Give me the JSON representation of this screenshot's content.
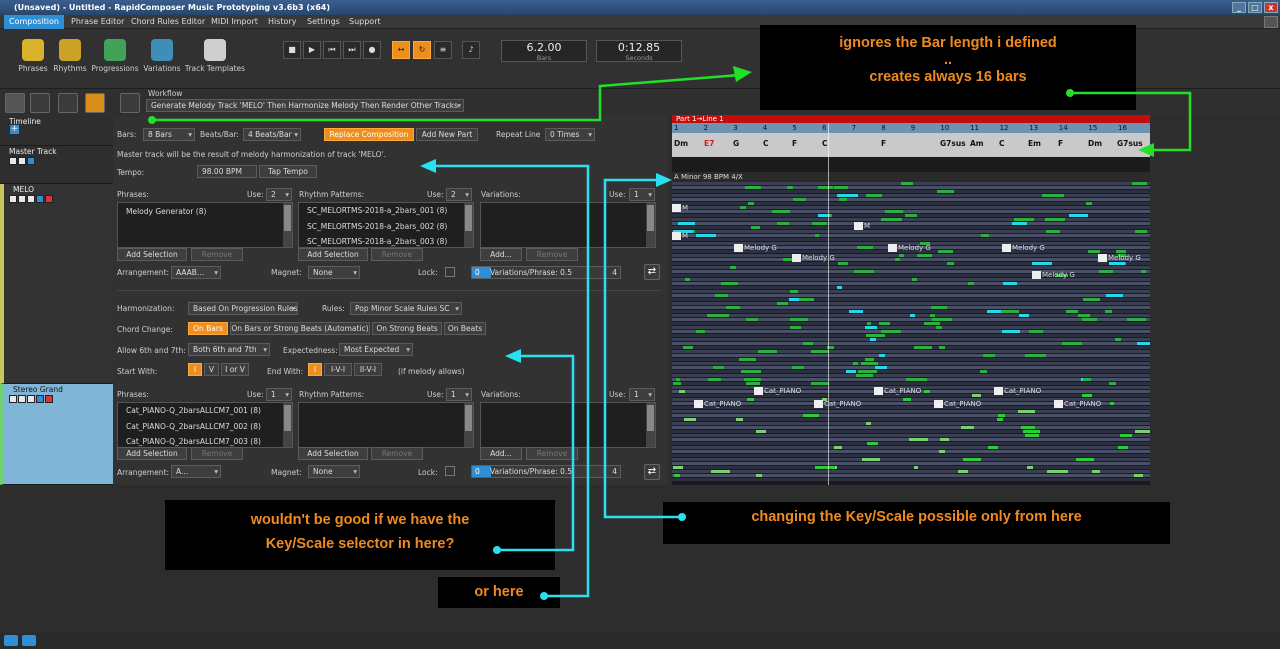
{
  "window": {
    "title": "(Unsaved) - Untitled - RapidComposer Music Prototyping v3.6b3 (x64)"
  },
  "menu": [
    "Composition",
    "Phrase Editor",
    "Chord Rules Editor",
    "MIDI Import",
    "History",
    "Settings",
    "Support"
  ],
  "toolbar": {
    "buttons": [
      "Phrases",
      "Rhythms",
      "Progressions",
      "Variations",
      "Track Templates"
    ],
    "position": {
      "value": "6.2.00",
      "unit": "Bars"
    },
    "time": {
      "value": "0:12.85",
      "unit": "Seconds"
    }
  },
  "workflow": {
    "label": "Workflow",
    "value": "Generate Melody Track 'MELO' Then Harmonize Melody Then Render Other Tracks"
  },
  "timeline": {
    "label": "Timeline",
    "bars_label": "Bars:",
    "bars": "8 Bars",
    "beats_label": "Beats/Bar:",
    "beats": "4 Beats/Bar",
    "replace": "Replace Composition",
    "addpart": "Add New Part",
    "repeat_label": "Repeat Line",
    "repeat": "0 Times"
  },
  "master": {
    "label": "Master Track",
    "desc": "Master track will be the result of melody harmonization of track 'MELO'.",
    "tempo_label": "Tempo:",
    "tempo": "98.00 BPM",
    "tap": "Tap Tempo"
  },
  "melo": {
    "name": "MELO",
    "phrases_label": "Phrases:",
    "use_label": "Use:",
    "use1": "2",
    "phrases": [
      "Melody Generator (8)"
    ],
    "rhythm_label": "Rhythm Patterns:",
    "use2": "2",
    "rhythms": [
      "SC_MELORTMS-2018-a_2bars_001 (8)",
      "SC_MELORTMS-2018-a_2bars_002 (8)",
      "SC_MELORTMS-2018-a_2bars_003 (8)"
    ],
    "var_label": "Variations:",
    "use3": "1",
    "add_sel": "Add Selection",
    "remove": "Remove",
    "add": "Add...",
    "arr_label": "Arrangement:",
    "arr": "AAAB...",
    "magnet_label": "Magnet:",
    "magnet": "None",
    "lock_label": "Lock:",
    "slider_min": "0",
    "slider_text": "Variations/Phrase: 0.5",
    "slider_max": "4",
    "variations_per_phrase": 0.125,
    "harm_label": "Harmonization:",
    "harm": "Based On Progression Rules",
    "rules_label": "Rules:",
    "rules": "Pop Minor Scale Rules SC",
    "chord_label": "Chord Change:",
    "chord_opts": [
      "On Bars",
      "On Bars or Strong Beats (Automatic)",
      "On Strong Beats",
      "On Beats"
    ],
    "allow_label": "Allow 6th and 7th:",
    "allow": "Both 6th and 7th",
    "expect_label": "Expectedness:",
    "expect": "Most Expected",
    "start_label": "Start With:",
    "start_opts": [
      "I",
      "V",
      "I or V"
    ],
    "end_label": "End With:",
    "end_opts": [
      "I",
      "I-V-I",
      "II-V-I"
    ],
    "end_note": "(if melody allows)"
  },
  "stereo": {
    "name": "Stereo Grand",
    "phrases_label": "Phrases:",
    "use_label": "Use:",
    "use1": "1",
    "phrases": [
      "Cat_PIANO-Q_2barsALLCM7_001 (8)",
      "Cat_PIANO-Q_2barsALLCM7_002 (8)",
      "Cat_PIANO-Q_2barsALLCM7_003 (8)"
    ],
    "rhythm_label": "Rhythm Patterns:",
    "use2": "1",
    "var_label": "Variations:",
    "use3": "1",
    "add_sel": "Add Selection",
    "remove": "Remove",
    "add": "Add...",
    "arr_label": "Arrangement:",
    "arr": "A...",
    "magnet_label": "Magnet:",
    "magnet": "None",
    "lock_label": "Lock:",
    "slider_min": "0",
    "slider_text": "Variations/Phrase: 0.5",
    "slider_max": "4"
  },
  "grid": {
    "part": "Part 1→Line 1",
    "bars": [
      "1",
      "2",
      "3",
      "4",
      "5",
      "6",
      "7",
      "8",
      "9",
      "10",
      "11",
      "12",
      "13",
      "14",
      "15",
      "16"
    ],
    "chords": [
      "Dm",
      "E7",
      "G",
      "C",
      "F",
      "C",
      "F",
      "G7sus",
      "Am",
      "C",
      "Em",
      "F",
      "Dm",
      "G7sus"
    ],
    "key": "A Minor  98 BPM  4/X",
    "clips": [
      {
        "t": "M",
        "r": 0
      },
      {
        "t": "M",
        "r": 1
      },
      {
        "t": "M",
        "r": 2
      },
      {
        "t": "Melody G",
        "r": 3
      },
      {
        "t": "Melody G",
        "r": 3
      },
      {
        "t": "Melody G",
        "r": 4
      },
      {
        "t": "Melody G",
        "r": 4
      },
      {
        "t": "Melody G",
        "r": 5
      },
      {
        "t": "Melody G",
        "r": 5
      }
    ],
    "piano_clips": [
      "Cat_PIANO",
      "Cat_PIANO",
      "Cat_PIANO",
      "Cat_PIANO",
      "Cat_PIANO",
      "Cat_PIANO",
      "Cat_PIANO"
    ]
  },
  "callouts": {
    "bars": [
      "ignores the Bar length i defined",
      "..",
      "creates always 16 bars"
    ],
    "key": "changing the Key/Scale possible only from here",
    "suggest": [
      "wouldn't be good if we have the",
      "Key/Scale selector in here?"
    ],
    "here": "or here"
  },
  "colors": {
    "accent": "#ee8e1c",
    "select": "#2f8fd5",
    "arrow_green": "#22e02a",
    "arrow_cyan": "#28e0f0",
    "callout_text": "#f08a1f"
  }
}
